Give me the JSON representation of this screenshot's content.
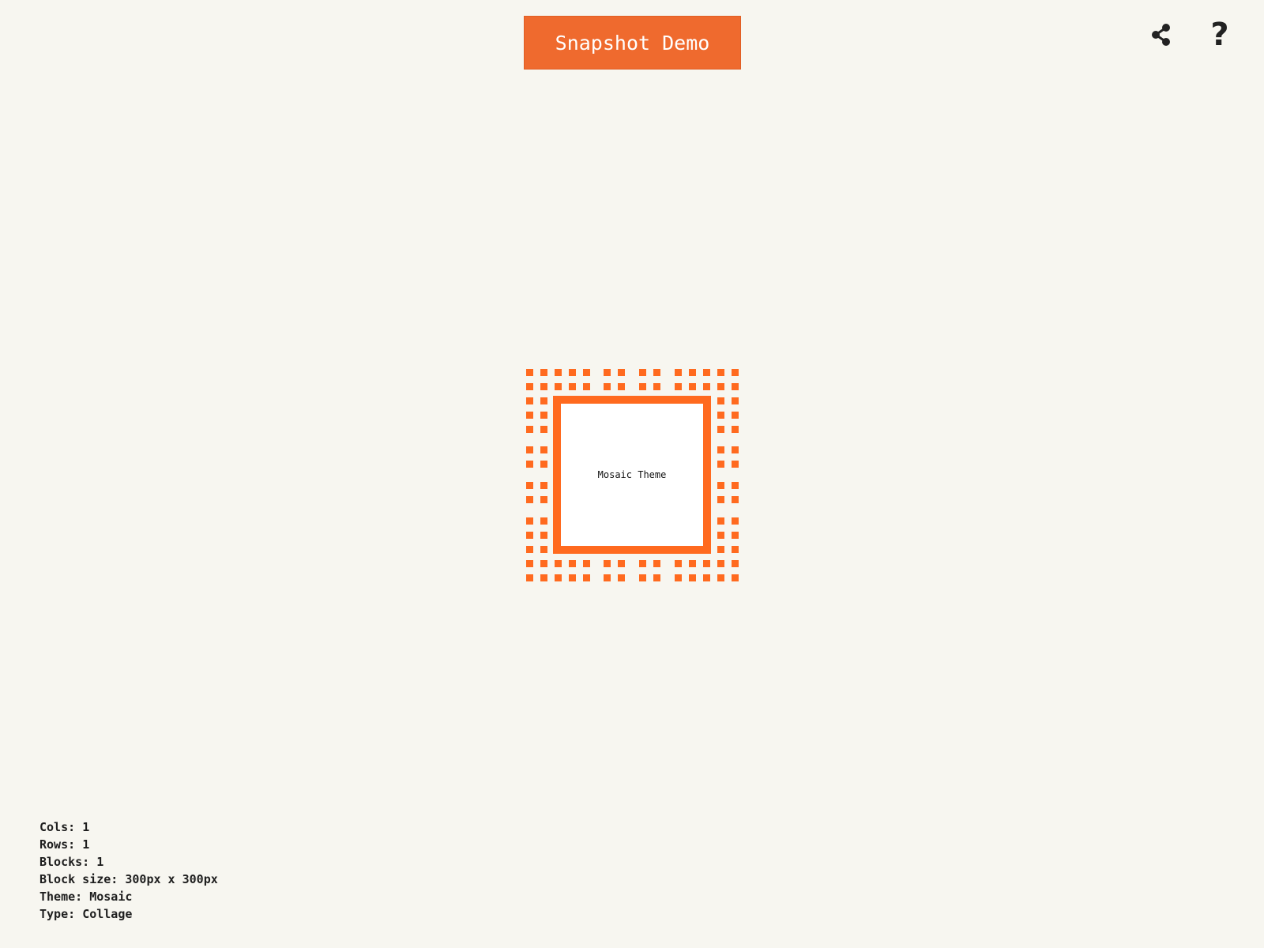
{
  "header": {
    "title": "Snapshot Demo",
    "share_icon": "share-icon",
    "help_icon": "help-icon",
    "help_glyph": "?"
  },
  "canvas": {
    "block_label": "Mosaic Theme",
    "accent_color": "#ff6a1f"
  },
  "info": {
    "lines": [
      {
        "label": "Cols:",
        "value": "1"
      },
      {
        "label": "Rows:",
        "value": "1"
      },
      {
        "label": "Blocks:",
        "value": "1"
      },
      {
        "label": "Block size:",
        "value": "300px x 300px"
      },
      {
        "label": "Theme:",
        "value": "Mosaic"
      },
      {
        "label": "Type:",
        "value": "Collage"
      }
    ]
  },
  "colors": {
    "background": "#f7f6f0",
    "title_button": "#ef6a2e",
    "mosaic_tile": "#ff6a1f"
  }
}
